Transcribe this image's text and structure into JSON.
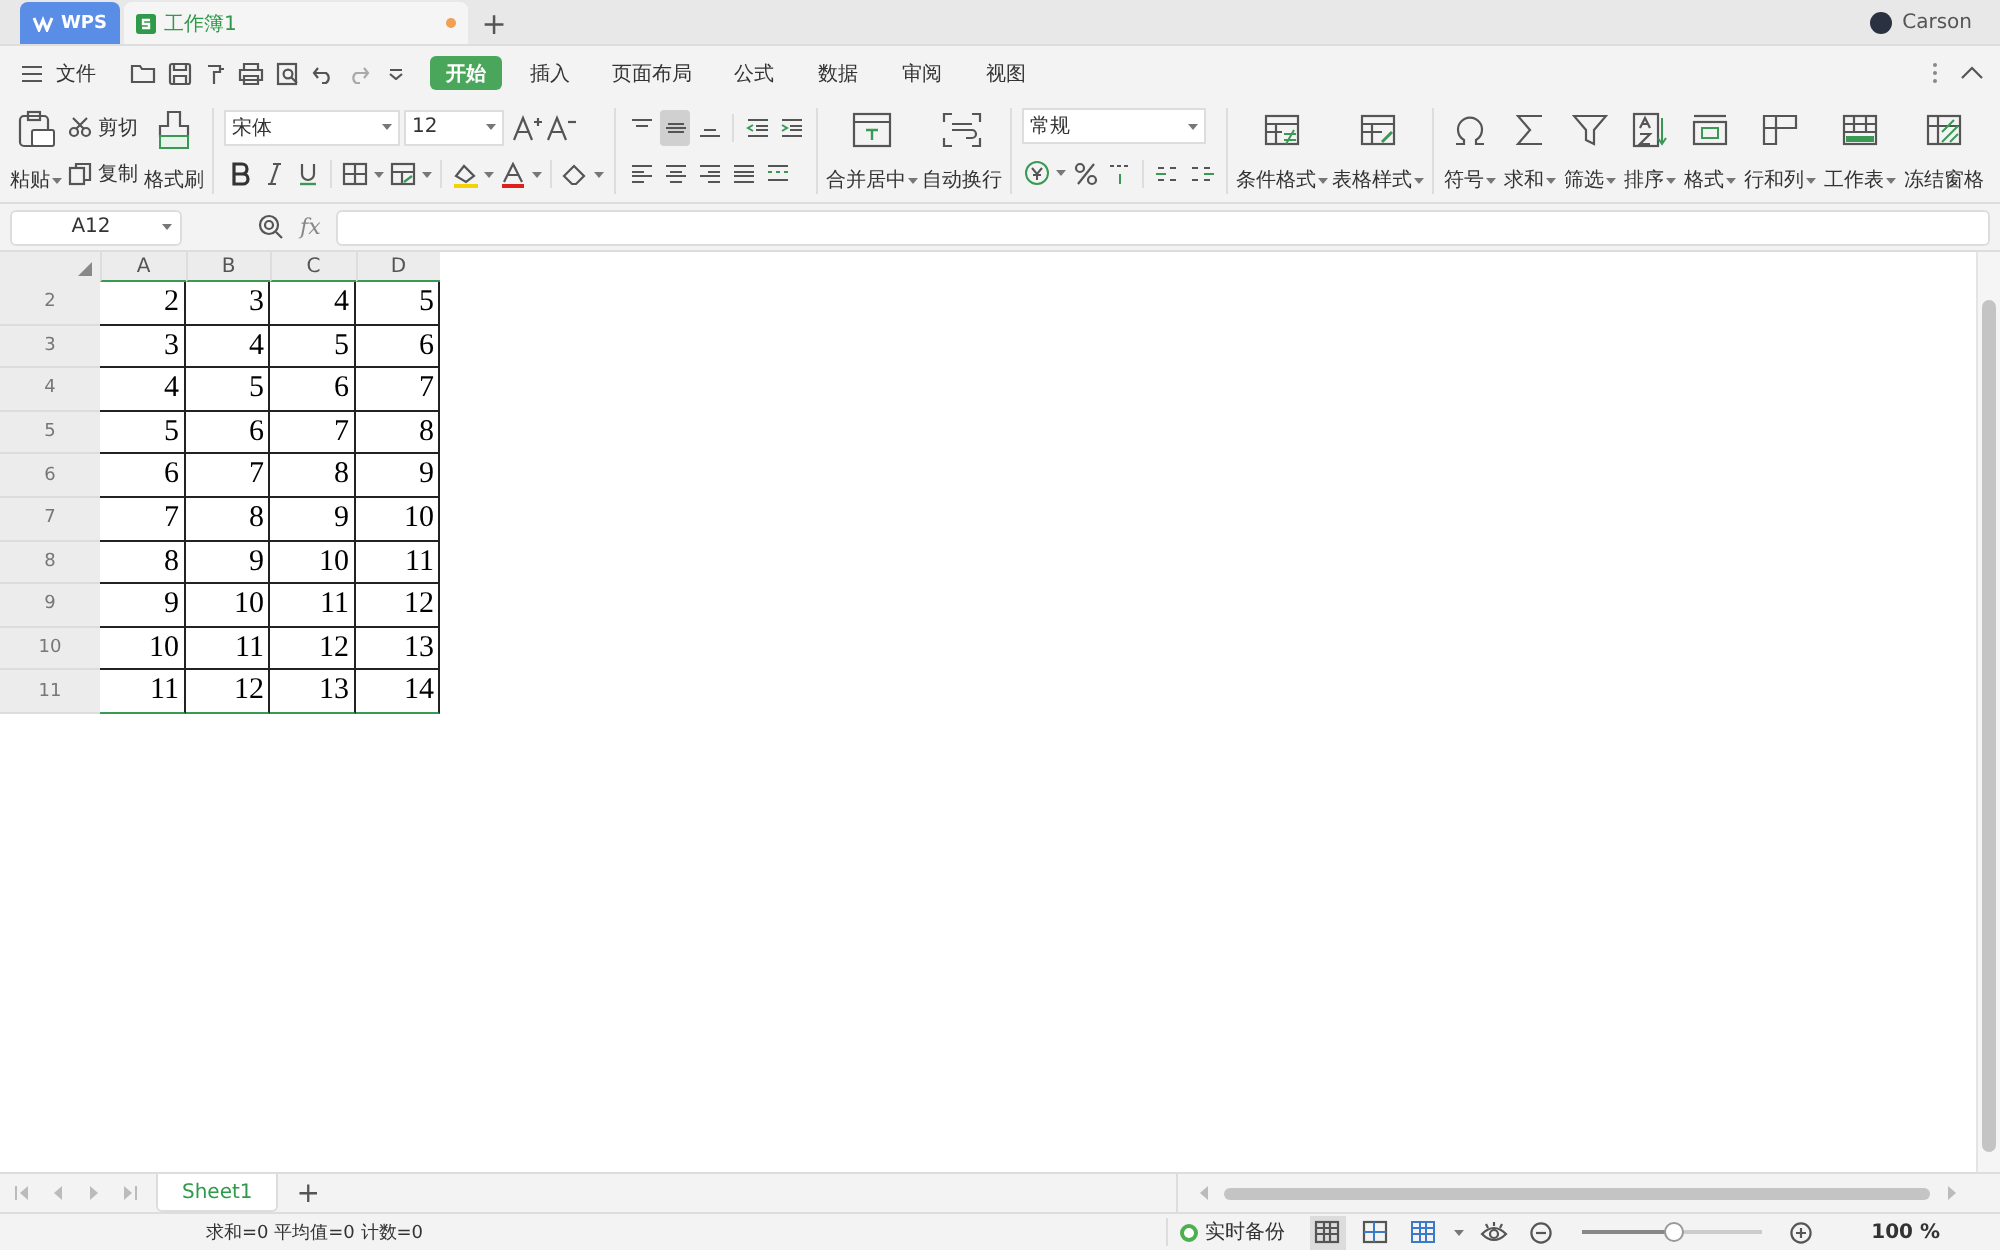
{
  "title_bar": {
    "app_tab": {
      "label": "WPS",
      "selected": false
    },
    "document_tab": {
      "label": "工作簿1",
      "selected": true,
      "modified": true
    },
    "new_tab": "+",
    "user": "Carson"
  },
  "menu_bar": {
    "file_menu": "文件",
    "ribbon_tabs": [
      {
        "label": "开始",
        "selected": true
      },
      {
        "label": "插入",
        "selected": false
      },
      {
        "label": "页面布局",
        "selected": false
      },
      {
        "label": "公式",
        "selected": false
      },
      {
        "label": "数据",
        "selected": false
      },
      {
        "label": "审阅",
        "selected": false
      },
      {
        "label": "视图",
        "selected": false
      }
    ]
  },
  "ribbon": {
    "paste": {
      "label": "粘贴",
      "has_menu": true
    },
    "cut": "剪切",
    "copy": "复制",
    "format_painter": "格式刷",
    "font_name": "宋体",
    "font_size": "12",
    "align_top": [
      {
        "selected": false
      },
      {
        "selected": true
      },
      {
        "selected": false
      }
    ],
    "merge": {
      "label": "合并居中",
      "has_menu": true
    },
    "wrap": {
      "label": "自动换行",
      "has_menu": false
    },
    "number_format": "常规",
    "style_buttons": [
      {
        "label": "条件格式",
        "has_menu": true
      },
      {
        "label": "表格样式",
        "has_menu": true
      }
    ],
    "tool_buttons": [
      {
        "label": "符号",
        "has_menu": true
      },
      {
        "label": "求和",
        "has_menu": true
      },
      {
        "label": "筛选",
        "has_menu": true
      },
      {
        "label": "排序",
        "has_menu": true
      },
      {
        "label": "格式",
        "has_menu": true
      },
      {
        "label": "行和列",
        "has_menu": true
      },
      {
        "label": "工作表",
        "has_menu": true
      },
      {
        "label": "冻结窗格",
        "has_menu": false
      }
    ]
  },
  "formula_bar": {
    "name_box": "A12",
    "fx": "fx"
  },
  "sheet": {
    "columns": [
      "A",
      "B",
      "C",
      "D"
    ],
    "rows": [
      {
        "header": "2",
        "cells": [
          "2",
          "3",
          "4",
          "5"
        ]
      },
      {
        "header": "3",
        "cells": [
          "3",
          "4",
          "5",
          "6"
        ]
      },
      {
        "header": "4",
        "cells": [
          "4",
          "5",
          "6",
          "7"
        ]
      },
      {
        "header": "5",
        "cells": [
          "5",
          "6",
          "7",
          "8"
        ]
      },
      {
        "header": "6",
        "cells": [
          "6",
          "7",
          "8",
          "9"
        ]
      },
      {
        "header": "7",
        "cells": [
          "7",
          "8",
          "9",
          "10"
        ]
      },
      {
        "header": "8",
        "cells": [
          "8",
          "9",
          "10",
          "11"
        ]
      },
      {
        "header": "9",
        "cells": [
          "9",
          "10",
          "11",
          "12"
        ]
      },
      {
        "header": "10",
        "cells": [
          "10",
          "11",
          "12",
          "13"
        ]
      },
      {
        "header": "11",
        "cells": [
          "11",
          "12",
          "13",
          "14"
        ]
      }
    ]
  },
  "sheet_tabs": [
    {
      "label": "Sheet1",
      "selected": true
    }
  ],
  "add_sheet": "+",
  "status_bar": {
    "summary": "求和=0 平均值=0 计数=0",
    "backup": "实时备份",
    "zoom": {
      "level": 0.52
    },
    "zoom_text": "100 %"
  }
}
